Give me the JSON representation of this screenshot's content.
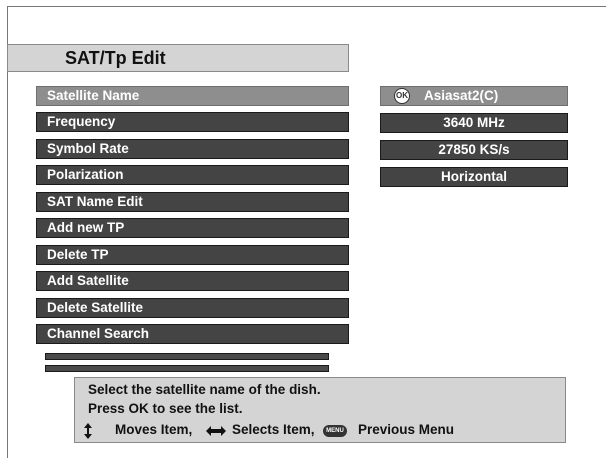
{
  "screen": {
    "title": "SAT/Tp Edit"
  },
  "menu": {
    "items": [
      {
        "label": "Satellite Name",
        "selected": true
      },
      {
        "label": "Frequency",
        "selected": false
      },
      {
        "label": "Symbol Rate",
        "selected": false
      },
      {
        "label": "Polarization",
        "selected": false
      },
      {
        "label": "SAT Name Edit",
        "selected": false
      },
      {
        "label": "Add new TP",
        "selected": false
      },
      {
        "label": "Delete TP",
        "selected": false
      },
      {
        "label": "Add Satellite",
        "selected": false
      },
      {
        "label": "Delete Satellite",
        "selected": false
      },
      {
        "label": "Channel Search",
        "selected": false
      }
    ]
  },
  "values": {
    "satellite_name": {
      "icon": "ok-button-icon",
      "icon_text": "OK",
      "text": "Asiasat2(C)"
    },
    "frequency": "3640  MHz",
    "symbol_rate": "27850 KS/s",
    "polarization": "Horizontal"
  },
  "help": {
    "line1": "Select the satellite name of the dish.",
    "line2": "Press OK to see the list.",
    "legend": {
      "updown_icon": "up-down-arrow-icon",
      "moves_label": "Moves Item,",
      "leftright_icon": "left-right-arrow-icon",
      "selects_label": "Selects Item,",
      "menu_icon": "menu-button-icon",
      "menu_icon_text": "MENU",
      "previous_label": "Previous Menu"
    }
  },
  "colors": {
    "item_bg": "#444444",
    "selected_bg": "#8e8e8e",
    "panel_bg": "#d4d4d4",
    "page_bg": "#ffffff"
  }
}
